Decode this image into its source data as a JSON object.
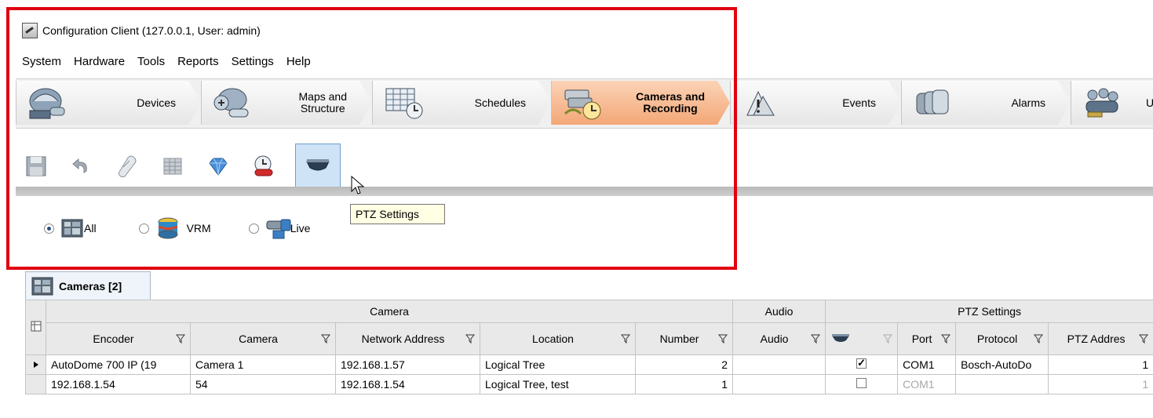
{
  "window": {
    "title": "Configuration Client (127.0.0.1, User: admin)"
  },
  "menu": [
    "System",
    "Hardware",
    "Tools",
    "Reports",
    "Settings",
    "Help"
  ],
  "workflow": [
    {
      "label": "Devices",
      "icon": "devices-icon"
    },
    {
      "label": "Maps and\nStructure",
      "icon": "maps-structure-icon"
    },
    {
      "label": "Schedules",
      "icon": "schedules-icon"
    },
    {
      "label": "Cameras and\nRecording",
      "icon": "cameras-recording-icon",
      "active": true
    },
    {
      "label": "Events",
      "icon": "events-icon"
    },
    {
      "label": "Alarms",
      "icon": "alarms-icon"
    },
    {
      "label": "U",
      "icon": "users-icon"
    }
  ],
  "toolbar": {
    "buttons": [
      "save-icon",
      "undo-icon",
      "delete-icon",
      "table-icon",
      "diamond-icon",
      "recording-settings-icon",
      "ptz-settings-icon"
    ],
    "selected": "ptz-settings-icon",
    "tooltip": "PTZ Settings"
  },
  "filter": [
    {
      "label": "All",
      "checked": true,
      "icon": "all-cameras-icon"
    },
    {
      "label": "VRM",
      "checked": false,
      "icon": "vrm-icon"
    },
    {
      "label": "Live",
      "checked": false,
      "icon": "live-icon"
    }
  ],
  "panel": {
    "tab_label": "Cameras [2]"
  },
  "table": {
    "groups": [
      {
        "label": "Camera",
        "span": 5
      },
      {
        "label": "Audio",
        "span": 1
      },
      {
        "label": "PTZ Settings",
        "span": 4
      }
    ],
    "columns": [
      "Encoder",
      "Camera",
      "Network Address",
      "Location",
      "Number",
      "Audio",
      "",
      "Port",
      "Protocol",
      "PTZ Addres"
    ],
    "rows": [
      {
        "encoder": "AutoDome 700 IP (19",
        "camera": "Camera 1",
        "network": "192.168.1.57",
        "location": "Logical Tree",
        "number": "2",
        "audio": "",
        "ptz": true,
        "port": "COM1",
        "protocol": "Bosch-AutoDo",
        "ptz_address": "1",
        "current": true
      },
      {
        "encoder": "192.168.1.54",
        "camera": "54",
        "network": "192.168.1.54",
        "location": "Logical Tree, test",
        "number": "1",
        "audio": "",
        "ptz": false,
        "port": "COM1",
        "protocol": "",
        "ptz_address": "1",
        "current": false
      }
    ]
  }
}
